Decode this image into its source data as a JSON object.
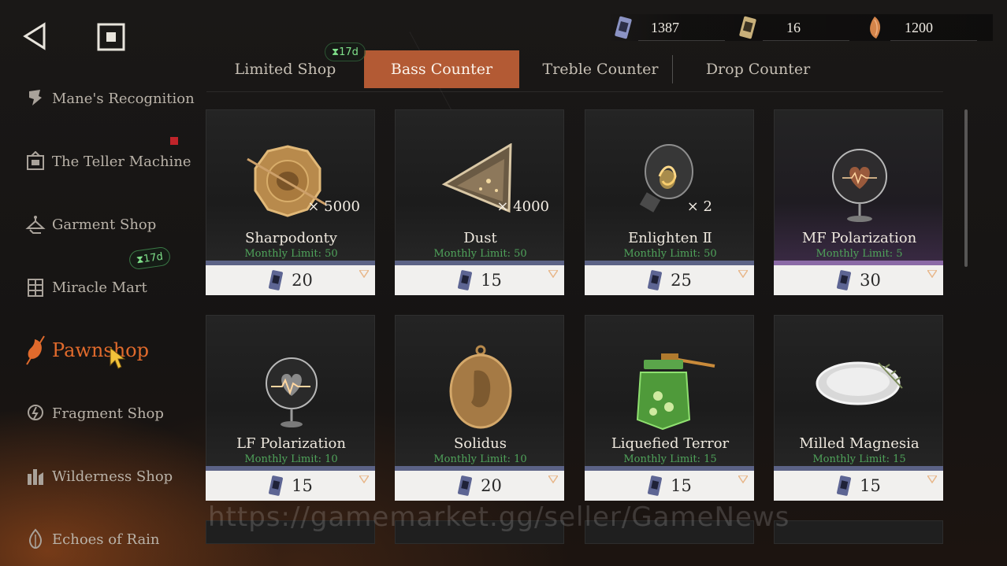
{
  "currencies": [
    {
      "icon": "cassette-ticket-icon",
      "value": "1387"
    },
    {
      "icon": "cassette-ticket-gold-icon",
      "value": "16"
    },
    {
      "icon": "amber-shard-icon",
      "value": "1200"
    }
  ],
  "sidebar": {
    "items": [
      {
        "label": "Mane's Recognition",
        "icon": "trophy-icon"
      },
      {
        "label": "The Teller Machine",
        "icon": "machine-icon"
      },
      {
        "label": "Garment Shop",
        "icon": "hanger-icon"
      },
      {
        "label": "Miracle Mart",
        "icon": "shelf-icon"
      },
      {
        "label": "Pawnshop",
        "icon": "pawnshop-icon"
      },
      {
        "label": "Fragment Shop",
        "icon": "fragment-icon"
      },
      {
        "label": "Wilderness Shop",
        "icon": "wilderness-icon"
      },
      {
        "label": "Echoes of Rain",
        "icon": "raindrop-icon"
      }
    ],
    "miracle_timer": "17d"
  },
  "tabs": {
    "items": [
      "Limited Shop",
      "Bass Counter",
      "Treble Counter",
      "Drop Counter"
    ],
    "active": "Bass Counter",
    "limited_timer": "17d"
  },
  "shop": {
    "items": [
      {
        "name": "Sharpodonty",
        "limit": "Monthly Limit: 50",
        "qty": "× 5000",
        "price": "20",
        "icon": "gold-coin-icon"
      },
      {
        "name": "Dust",
        "limit": "Monthly Limit: 50",
        "qty": "× 4000",
        "price": "15",
        "icon": "dust-prism-icon"
      },
      {
        "name": "Enlighten Ⅱ",
        "limit": "Monthly Limit: 50",
        "qty": "× 2",
        "price": "25",
        "icon": "lightbulb-icon"
      },
      {
        "name": "MF Polarization",
        "limit": "Monthly Limit: 5",
        "qty": "",
        "price": "30",
        "icon": "heart-globe-icon"
      },
      {
        "name": "LF Polarization",
        "limit": "Monthly Limit: 10",
        "qty": "",
        "price": "15",
        "icon": "heart-globe-icon"
      },
      {
        "name": "Solidus",
        "limit": "Monthly Limit: 10",
        "qty": "",
        "price": "20",
        "icon": "medallion-icon"
      },
      {
        "name": "Liquefied Terror",
        "limit": "Monthly Limit: 15",
        "qty": "",
        "price": "15",
        "icon": "honey-jar-icon"
      },
      {
        "name": "Milled Magnesia",
        "limit": "Monthly Limit: 15",
        "qty": "",
        "price": "15",
        "icon": "powder-bowl-icon"
      }
    ]
  },
  "watermark": "https://gamemarket.gg/seller/GameNews",
  "colors": {
    "accent": "#b35a34",
    "active_label": "#e06a2c",
    "limit_green": "#4fa35a",
    "rare_strip": "#8b6aa6",
    "common_strip": "#5c6386"
  }
}
